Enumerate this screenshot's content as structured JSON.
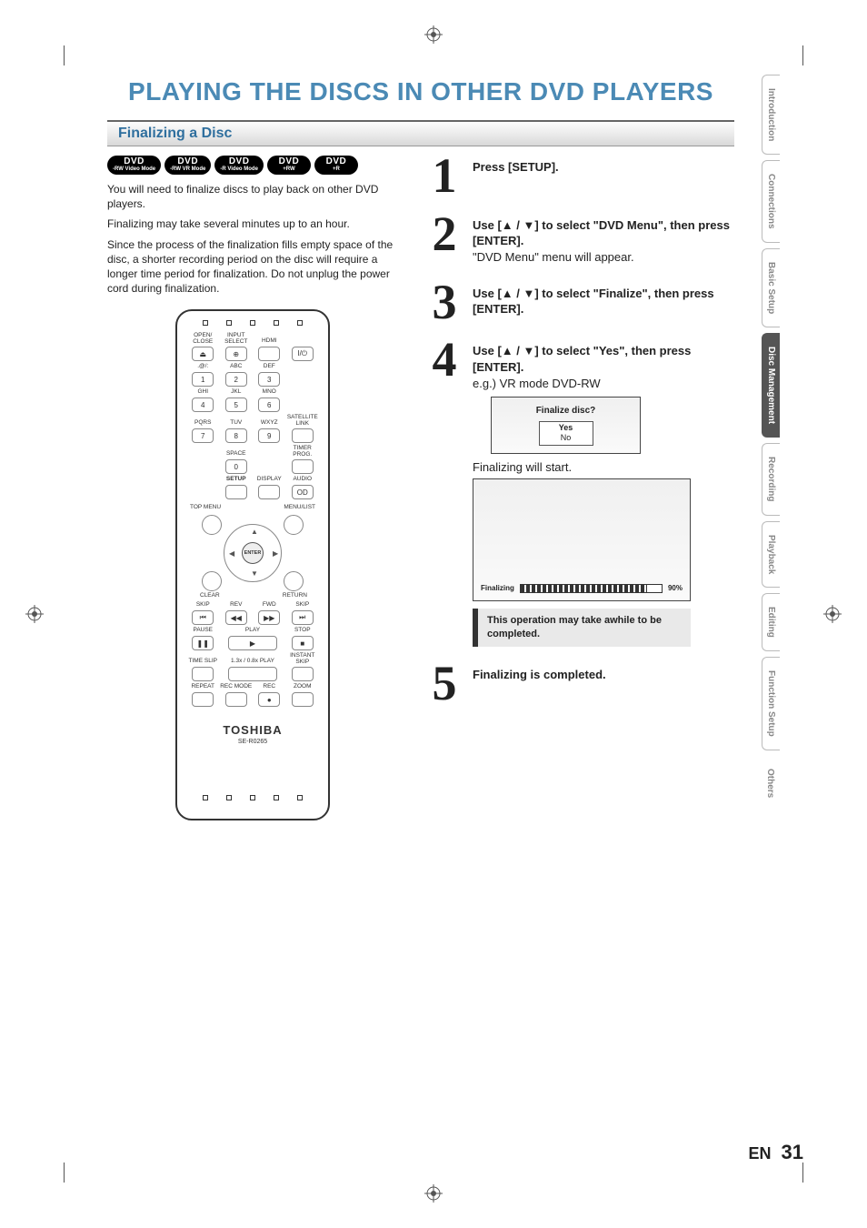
{
  "page": {
    "title": "PLAYING THE DISCS IN OTHER DVD PLAYERS",
    "section_header": "Finalizing a Disc",
    "lang": "EN",
    "number": "31"
  },
  "disc_badges": [
    {
      "top": "DVD",
      "bottom": "-RW Video Mode"
    },
    {
      "top": "DVD",
      "bottom": "-RW VR Mode"
    },
    {
      "top": "DVD",
      "bottom": "-R Video Mode"
    },
    {
      "top": "DVD",
      "bottom": "+RW"
    },
    {
      "top": "DVD",
      "bottom": "+R"
    }
  ],
  "intro": {
    "p1": "You will need to finalize discs to play back on other DVD players.",
    "p2": "Finalizing may take several minutes up to an hour.",
    "p3": "Since the process of the finalization fills empty space of the disc, a shorter recording period on the disc will require a longer time period for finalization. Do not unplug the power cord during finalization."
  },
  "remote": {
    "brand": "TOSHIBA",
    "model": "SE-R0265",
    "labels": {
      "open_close": "OPEN/\nCLOSE",
      "input_select": "INPUT\nSELECT",
      "hdmi": "HDMI",
      "power": "I/⏻",
      "abc": "ABC",
      "def": "DEF",
      "at": ".@/:",
      "ghi": "GHI",
      "jkl": "JKL",
      "mno": "MNO",
      "pqrs": "PQRS",
      "tuv": "TUV",
      "wxyz": "WXYZ",
      "sat": "SATELLITE\nLINK",
      "space": "SPACE",
      "timer": "TIMER\nPROG.",
      "setup": "SETUP",
      "display": "DISPLAY",
      "audio": "AUDIO",
      "topmenu": "TOP MENU",
      "menulist": "MENU/LIST",
      "clear": "CLEAR",
      "return": "RETURN",
      "enter": "ENTER",
      "skip": "SKIP",
      "rev": "REV",
      "fwd": "FWD",
      "skip2": "SKIP",
      "pause": "PAUSE",
      "play": "PLAY",
      "stop": "STOP",
      "timeslip": "TIME SLIP",
      "rate": "1.3x / 0.8x PLAY",
      "instant": "INSTANT SKIP",
      "repeat": "REPEAT",
      "recmode": "REC MODE",
      "rec": "REC",
      "zoom": "ZOOM"
    },
    "keys": {
      "1": "1",
      "2": "2",
      "3": "3",
      "4": "4",
      "5": "5",
      "6": "6",
      "7": "7",
      "8": "8",
      "9": "9",
      "0": "0"
    }
  },
  "steps": {
    "s1": {
      "num": "1",
      "text": "Press [SETUP]."
    },
    "s2": {
      "num": "2",
      "main": "Use [▲ / ▼] to select \"DVD Menu\", then press [ENTER].",
      "sub": "\"DVD Menu\" menu will appear."
    },
    "s3": {
      "num": "3",
      "main": "Use [▲ / ▼] to select \"Finalize\", then press [ENTER]."
    },
    "s4": {
      "num": "4",
      "main": "Use [▲ / ▼] to select \"Yes\", then press [ENTER].",
      "eg": "e.g.) VR mode DVD-RW",
      "dialog_title": "Finalize disc?",
      "opt_yes": "Yes",
      "opt_no": "No",
      "start_text": "Finalizing will start.",
      "progress_label": "Finalizing",
      "progress_pct": "90%",
      "note": "This operation may take awhile to be completed."
    },
    "s5": {
      "num": "5",
      "text": "Finalizing is completed."
    }
  },
  "side_tabs": [
    {
      "label": "Introduction",
      "active": false
    },
    {
      "label": "Connections",
      "active": false
    },
    {
      "label": "Basic Setup",
      "active": false
    },
    {
      "label": "Disc Management",
      "active": true
    },
    {
      "label": "Recording",
      "active": false
    },
    {
      "label": "Playback",
      "active": false
    },
    {
      "label": "Editing",
      "active": false
    },
    {
      "label": "Function Setup",
      "active": false
    },
    {
      "label": "Others",
      "active": false
    }
  ]
}
